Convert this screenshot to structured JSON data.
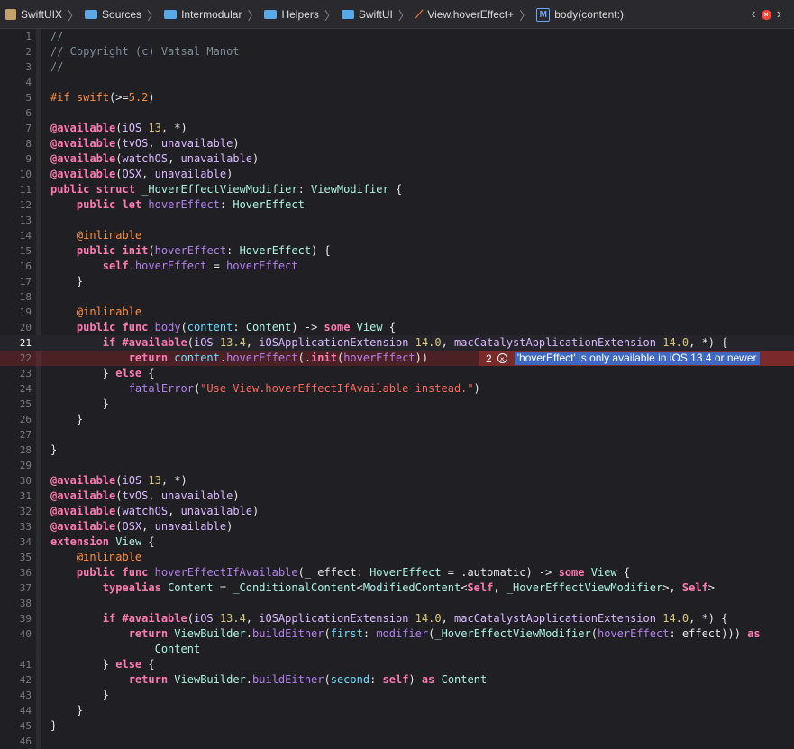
{
  "breadcrumbs": [
    {
      "label": "SwiftUIX",
      "icon": "package-icon"
    },
    {
      "label": "Sources",
      "icon": "folder-icon"
    },
    {
      "label": "Intermodular",
      "icon": "folder-icon"
    },
    {
      "label": "Helpers",
      "icon": "folder-icon"
    },
    {
      "label": "SwiftUI",
      "icon": "folder-icon"
    },
    {
      "label": "View.hoverEffect+",
      "icon": "swift-file-icon"
    },
    {
      "label": "body(content:)",
      "icon": "method-icon",
      "badge": "M"
    }
  ],
  "nav": {
    "back": "‹",
    "error_badge": "×",
    "forward": "›"
  },
  "error": {
    "line": 22,
    "count": "2",
    "message": "'hoverEffect' is only available in iOS 13.4 or newer"
  },
  "current_line": 21,
  "lines": [
    {
      "n": "1",
      "t": "//"
    },
    {
      "n": "2",
      "t": "// Copyright (c) Vatsal Manot"
    },
    {
      "n": "3",
      "t": "//"
    },
    {
      "n": "4",
      "t": ""
    },
    {
      "n": "5",
      "t": "#if swift(>=5.2)"
    },
    {
      "n": "6",
      "t": ""
    },
    {
      "n": "7",
      "t": "@available(iOS 13, *)"
    },
    {
      "n": "8",
      "t": "@available(tvOS, unavailable)"
    },
    {
      "n": "9",
      "t": "@available(watchOS, unavailable)"
    },
    {
      "n": "10",
      "t": "@available(OSX, unavailable)"
    },
    {
      "n": "11",
      "t": "public struct _HoverEffectViewModifier: ViewModifier {"
    },
    {
      "n": "12",
      "t": "    public let hoverEffect: HoverEffect"
    },
    {
      "n": "13",
      "t": ""
    },
    {
      "n": "14",
      "t": "    @inlinable"
    },
    {
      "n": "15",
      "t": "    public init(hoverEffect: HoverEffect) {"
    },
    {
      "n": "16",
      "t": "        self.hoverEffect = hoverEffect"
    },
    {
      "n": "17",
      "t": "    }"
    },
    {
      "n": "18",
      "t": ""
    },
    {
      "n": "19",
      "t": "    @inlinable"
    },
    {
      "n": "20",
      "t": "    public func body(content: Content) -> some View {"
    },
    {
      "n": "21",
      "t": "        if #available(iOS 13.4, iOSApplicationExtension 14.0, macCatalystApplicationExtension 14.0, *) {"
    },
    {
      "n": "22",
      "t": "            return content.hoverEffect(.init(hoverEffect))"
    },
    {
      "n": "23",
      "t": "        } else {"
    },
    {
      "n": "24",
      "t": "            fatalError(\"Use View.hoverEffectIfAvailable instead.\")"
    },
    {
      "n": "25",
      "t": "        }"
    },
    {
      "n": "26",
      "t": "    }"
    },
    {
      "n": "27",
      "t": ""
    },
    {
      "n": "28",
      "t": "}"
    },
    {
      "n": "29",
      "t": ""
    },
    {
      "n": "30",
      "t": "@available(iOS 13, *)"
    },
    {
      "n": "31",
      "t": "@available(tvOS, unavailable)"
    },
    {
      "n": "32",
      "t": "@available(watchOS, unavailable)"
    },
    {
      "n": "33",
      "t": "@available(OSX, unavailable)"
    },
    {
      "n": "34",
      "t": "extension View {"
    },
    {
      "n": "35",
      "t": "    @inlinable"
    },
    {
      "n": "36",
      "t": "    public func hoverEffectIfAvailable(_ effect: HoverEffect = .automatic) -> some View {"
    },
    {
      "n": "37",
      "t": "        typealias Content = _ConditionalContent<ModifiedContent<Self, _HoverEffectViewModifier>, Self>"
    },
    {
      "n": "38",
      "t": ""
    },
    {
      "n": "39",
      "t": "        if #available(iOS 13.4, iOSApplicationExtension 14.0, macCatalystApplicationExtension 14.0, *) {"
    },
    {
      "n": "40",
      "t": "            return ViewBuilder.buildEither(first: modifier(_HoverEffectViewModifier(hoverEffect: effect))) as"
    },
    {
      "n": "",
      "t": "                Content"
    },
    {
      "n": "41",
      "t": "        } else {"
    },
    {
      "n": "42",
      "t": "            return ViewBuilder.buildEither(second: self) as Content"
    },
    {
      "n": "43",
      "t": "        }"
    },
    {
      "n": "44",
      "t": "    }"
    },
    {
      "n": "45",
      "t": "}"
    },
    {
      "n": "46",
      "t": ""
    }
  ]
}
